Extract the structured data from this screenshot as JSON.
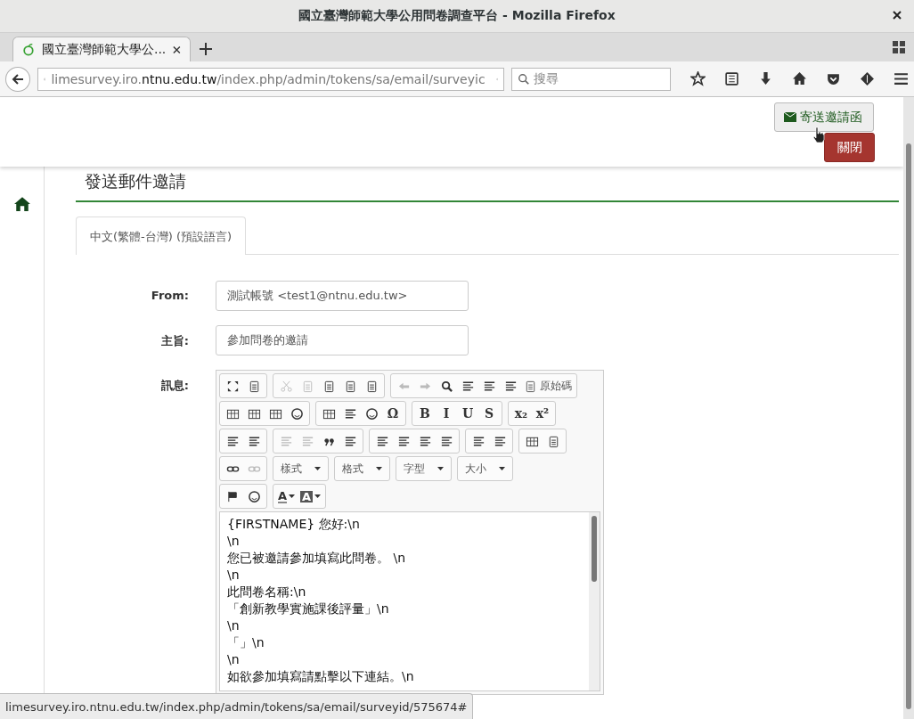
{
  "window": {
    "title": "國立臺灣師範大學公用問卷調查平台 - Mozilla Firefox"
  },
  "browser": {
    "tabs": [
      {
        "label": "國立臺灣師範大學公...",
        "selected": true
      }
    ],
    "url_host_pre": "limesurvey.iro.",
    "url_host_main": "ntnu.edu.tw",
    "url_path": "/index.php/admin/tokens/sa/email/surveyic",
    "search_placeholder": "搜尋"
  },
  "header": {
    "send_button": "寄送邀請函",
    "close_button": "關閉"
  },
  "page": {
    "heading": "發送郵件邀請",
    "language_tabs": [
      {
        "label": "中文(繁體-台灣) (預設語言)",
        "selected": true
      }
    ]
  },
  "form": {
    "from_label": "From:",
    "from_value": "測試帳號 <test1@ntnu.edu.tw>",
    "subject_label": "主旨:",
    "subject_value": "參加問卷的邀請",
    "message_label": "訊息:"
  },
  "editor": {
    "toolbar": [
      [
        [
          {
            "kind": "icon",
            "disabled": false
          },
          {
            "kind": "icon",
            "disabled": false
          }
        ],
        [
          {
            "kind": "icon",
            "disabled": true
          },
          {
            "kind": "icon",
            "disabled": true
          },
          {
            "kind": "icon",
            "disabled": false
          },
          {
            "kind": "icon",
            "disabled": false
          },
          {
            "kind": "icon",
            "disabled": false
          }
        ],
        [
          {
            "kind": "icon",
            "disabled": true
          },
          {
            "kind": "icon",
            "disabled": true
          },
          {
            "kind": "icon",
            "disabled": false
          },
          {
            "kind": "icon",
            "disabled": false
          },
          {
            "kind": "icon",
            "disabled": false
          },
          {
            "kind": "icon",
            "disabled": false
          },
          {
            "kind": "labeled",
            "label": "原始碼",
            "disabled": false
          }
        ]
      ],
      [
        [
          {
            "kind": "icon",
            "disabled": false
          },
          {
            "kind": "icon",
            "disabled": false
          },
          {
            "kind": "icon",
            "disabled": false
          },
          {
            "kind": "icon",
            "disabled": false
          }
        ],
        [
          {
            "kind": "icon",
            "disabled": false
          },
          {
            "kind": "icon",
            "disabled": false
          },
          {
            "kind": "icon",
            "disabled": false
          },
          {
            "kind": "glyph",
            "glyph": "Ω",
            "disabled": false
          }
        ],
        [
          {
            "kind": "glyph",
            "glyph": "B",
            "disabled": false
          },
          {
            "kind": "glyph",
            "glyph": "I",
            "disabled": false
          },
          {
            "kind": "glyph",
            "glyph": "U",
            "disabled": false
          },
          {
            "kind": "glyph",
            "glyph": "S",
            "disabled": false
          }
        ],
        [
          {
            "kind": "glyph",
            "glyph": "x₂",
            "disabled": false
          },
          {
            "kind": "glyph",
            "glyph": "x²",
            "disabled": false
          }
        ]
      ],
      [
        [
          {
            "kind": "icon",
            "disabled": false
          },
          {
            "kind": "icon",
            "disabled": false
          }
        ],
        [
          {
            "kind": "icon",
            "disabled": true
          },
          {
            "kind": "icon",
            "disabled": true
          },
          {
            "kind": "icon",
            "disabled": false
          },
          {
            "kind": "icon",
            "disabled": false
          }
        ],
        [
          {
            "kind": "icon",
            "disabled": false
          },
          {
            "kind": "icon",
            "disabled": false
          },
          {
            "kind": "icon",
            "disabled": false
          },
          {
            "kind": "icon",
            "disabled": false
          }
        ],
        [
          {
            "kind": "icon",
            "disabled": false
          },
          {
            "kind": "icon",
            "disabled": false
          }
        ],
        [
          {
            "kind": "icon",
            "disabled": false
          },
          {
            "kind": "icon",
            "disabled": false
          }
        ]
      ],
      [
        [
          {
            "kind": "icon",
            "disabled": false
          },
          {
            "kind": "icon",
            "disabled": true
          }
        ],
        [
          {
            "kind": "dropdown",
            "label": "樣式"
          }
        ],
        [
          {
            "kind": "dropdown",
            "label": "格式"
          }
        ],
        [
          {
            "kind": "dropdown",
            "label": "字型"
          }
        ],
        [
          {
            "kind": "dropdown",
            "label": "大小"
          }
        ]
      ],
      [
        [
          {
            "kind": "icon",
            "disabled": false
          },
          {
            "kind": "icon",
            "disabled": false
          }
        ],
        [
          {
            "kind": "text-color",
            "glyph": "A"
          },
          {
            "kind": "background-color",
            "glyph": "A"
          }
        ]
      ]
    ],
    "lines": [
      "{FIRSTNAME} 您好:\\n",
      "\\n",
      "您已被邀請參加填寫此問卷。 \\n",
      "\\n",
      "此問卷名稱:\\n",
      "「創新教學實施課後評量」\\n",
      "\\n",
      "「」\\n",
      "\\n",
      "如欲參加填寫請點擊以下連結。\\n"
    ]
  },
  "status_bar": "limesurvey.iro.ntnu.edu.tw/index.php/admin/tokens/sa/email/surveyid/575674#"
}
